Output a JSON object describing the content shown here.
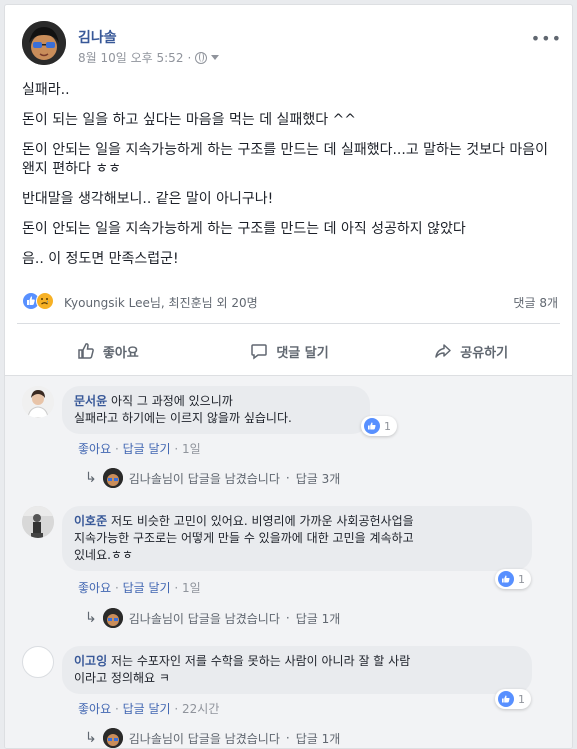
{
  "post": {
    "author": "김나솔",
    "timestamp": "8월 10일 오후 5:52",
    "separator": "·",
    "menu_label": "•••",
    "paragraphs": [
      "실패라..",
      "돈이 되는 일을 하고 싶다는 마음을 먹는 데 실패했다 ^^",
      "돈이 안되는 일을 지속가능하게 하는 구조를 만드는 데 실패했다...고 말하는 것보다 마음이 왠지 편하다 ㅎㅎ",
      "반대말을 생각해보니.. 같은 말이 아니구나!",
      "돈이 안되는 일을 지속가능하게 하는 구조를 만드는 데 아직 성공하지 않았다",
      "음.. 이 정도면 만족스럽군!"
    ],
    "reactions": {
      "names": "Kyoungsik Lee님, 최진훈님 외 20명",
      "comment_count": "댓글 8개"
    },
    "actions": {
      "like": "좋아요",
      "comment": "댓글 달기",
      "share": "공유하기"
    }
  },
  "comments": [
    {
      "name": "문서윤",
      "text_line1": "아직 그 과정에 있으니까",
      "text_line2": "실패라고 하기에는 이르지 않을까 싶습니다.",
      "like_count": "1",
      "like_label": "좋아요",
      "reply_label": "답글 달기",
      "time": "1일",
      "reply_summary": "김나솔님이 답글을 남겼습니다",
      "reply_count": "답글 3개"
    },
    {
      "name": "이호준",
      "text_line1": "저도 비슷한 고민이 있어요. 비영리에 가까운 사회공헌사업을",
      "text_line2": "지속가능한 구조로는 어떻게 만들 수 있을까에 대한 고민을 계속하고",
      "text_line3": "있네요.ㅎㅎ",
      "like_count": "1",
      "like_label": "좋아요",
      "reply_label": "답글 달기",
      "time": "1일",
      "reply_summary": "김나솔님이 답글을 남겼습니다",
      "reply_count": "답글 1개"
    },
    {
      "name": "이고잉",
      "text_line1": "저는 수포자인 저를 수학을 못하는 사람이 아니라 잘 할 사람",
      "text_line2": "이라고 정의해요 ㅋ",
      "like_count": "1",
      "like_label": "좋아요",
      "reply_label": "답글 달기",
      "time": "22시간",
      "reply_summary": "김나솔님이 답글을 남겼습니다",
      "reply_count": "답글 1개"
    }
  ],
  "colors": {
    "link": "#385898",
    "like_blue": "#5890ff",
    "bubble": "#e9ebee"
  }
}
